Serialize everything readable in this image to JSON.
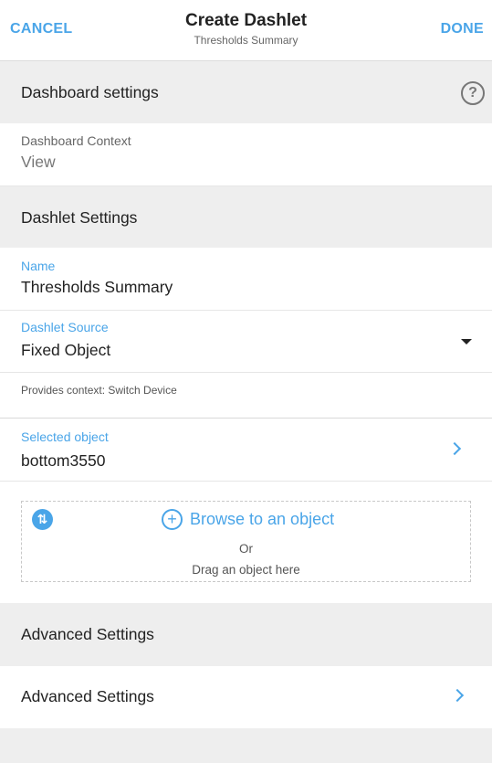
{
  "header": {
    "cancel_label": "CANCEL",
    "title": "Create Dashlet",
    "subtitle": "Thresholds Summary",
    "done_label": "DONE"
  },
  "dashboard_settings": {
    "section_title": "Dashboard settings",
    "help_icon": "?",
    "context_caption": "Dashboard Context",
    "context_value": "View"
  },
  "dashlet_settings": {
    "section_title": "Dashlet Settings",
    "name_caption": "Name",
    "name_value": "Thresholds Summary",
    "source_caption": "Dashlet Source",
    "source_value": "Fixed Object",
    "provides_context": "Provides context: Switch Device",
    "selected_caption": "Selected object",
    "selected_value": "bottom3550"
  },
  "drop_zone": {
    "swap_icon": "⇅",
    "plus_icon": "+",
    "browse_label": "Browse to an object",
    "or_label": "Or",
    "drag_label": "Drag an object here"
  },
  "advanced": {
    "section_title": "Advanced Settings",
    "row_label": "Advanced Settings"
  },
  "colors": {
    "accent": "#4aa5e8",
    "section_bg": "#eeeeee"
  }
}
